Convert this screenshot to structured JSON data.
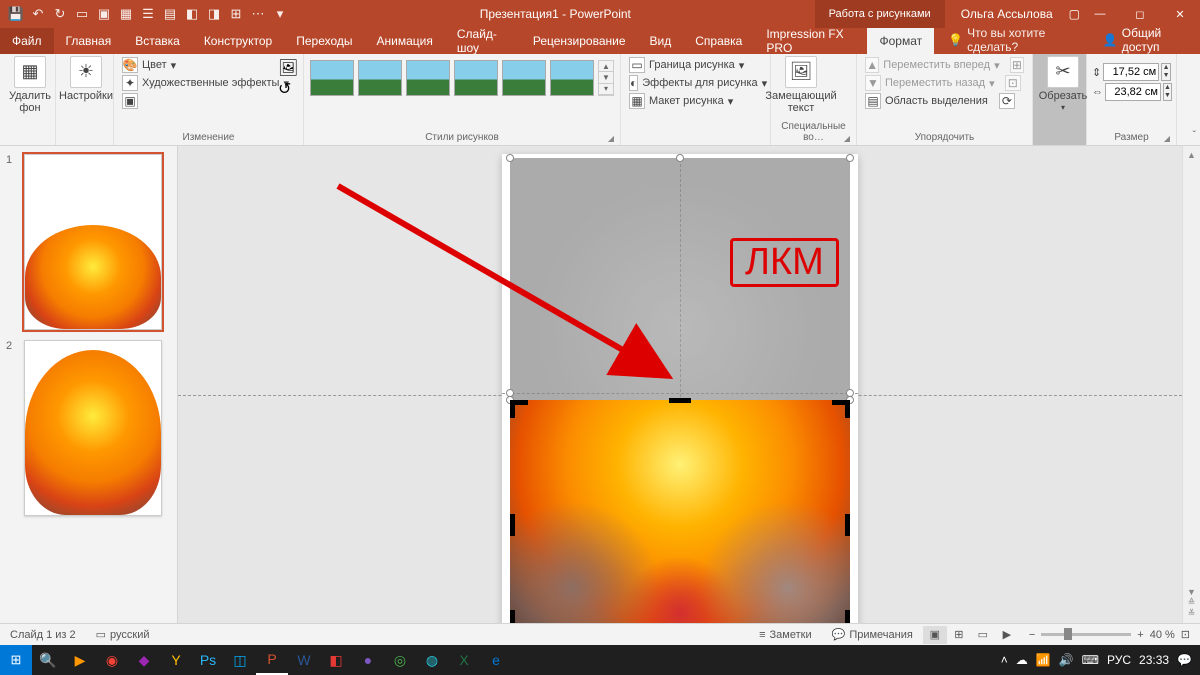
{
  "title": {
    "doc": "Презентация1 - PowerPoint",
    "context": "Работа с рисунками",
    "user": "Ольга Ассылова"
  },
  "tabs": {
    "file": "Файл",
    "items": [
      "Главная",
      "Вставка",
      "Конструктор",
      "Переходы",
      "Анимация",
      "Слайд-шоу",
      "Рецензирование",
      "Вид",
      "Справка",
      "Impression FX PRO"
    ],
    "active": "Формат",
    "tell": "Что вы хотите сделать?",
    "share": "Общий доступ"
  },
  "ribbon": {
    "remove_bg": "Удалить\nфон",
    "corrections": "Настройки",
    "color": "Цвет",
    "artistic": "Художественные эффекты",
    "group_adjust": "Изменение",
    "group_styles": "Стили рисунков",
    "border": "Граница рисунка",
    "effects": "Эффекты для рисунка",
    "layout": "Макет рисунка",
    "alt_text": "Замещающий\nтекст",
    "group_alt": "Специальные во…",
    "bring_fwd": "Переместить вперед",
    "send_back": "Переместить назад",
    "selection_pane": "Область выделения",
    "group_arrange": "Упорядочить",
    "crop": "Обрезать",
    "height": "17,52 см",
    "width": "23,82 см",
    "group_size": "Размер"
  },
  "slides": {
    "s1": "1",
    "s2": "2"
  },
  "annotation": "ЛКМ",
  "status": {
    "slide_of": "Слайд 1 из 2",
    "lang": "русский",
    "notes": "Заметки",
    "comments": "Примечания",
    "zoom": "40 %"
  },
  "taskbar": {
    "lang": "РУС",
    "time": "23:33"
  }
}
